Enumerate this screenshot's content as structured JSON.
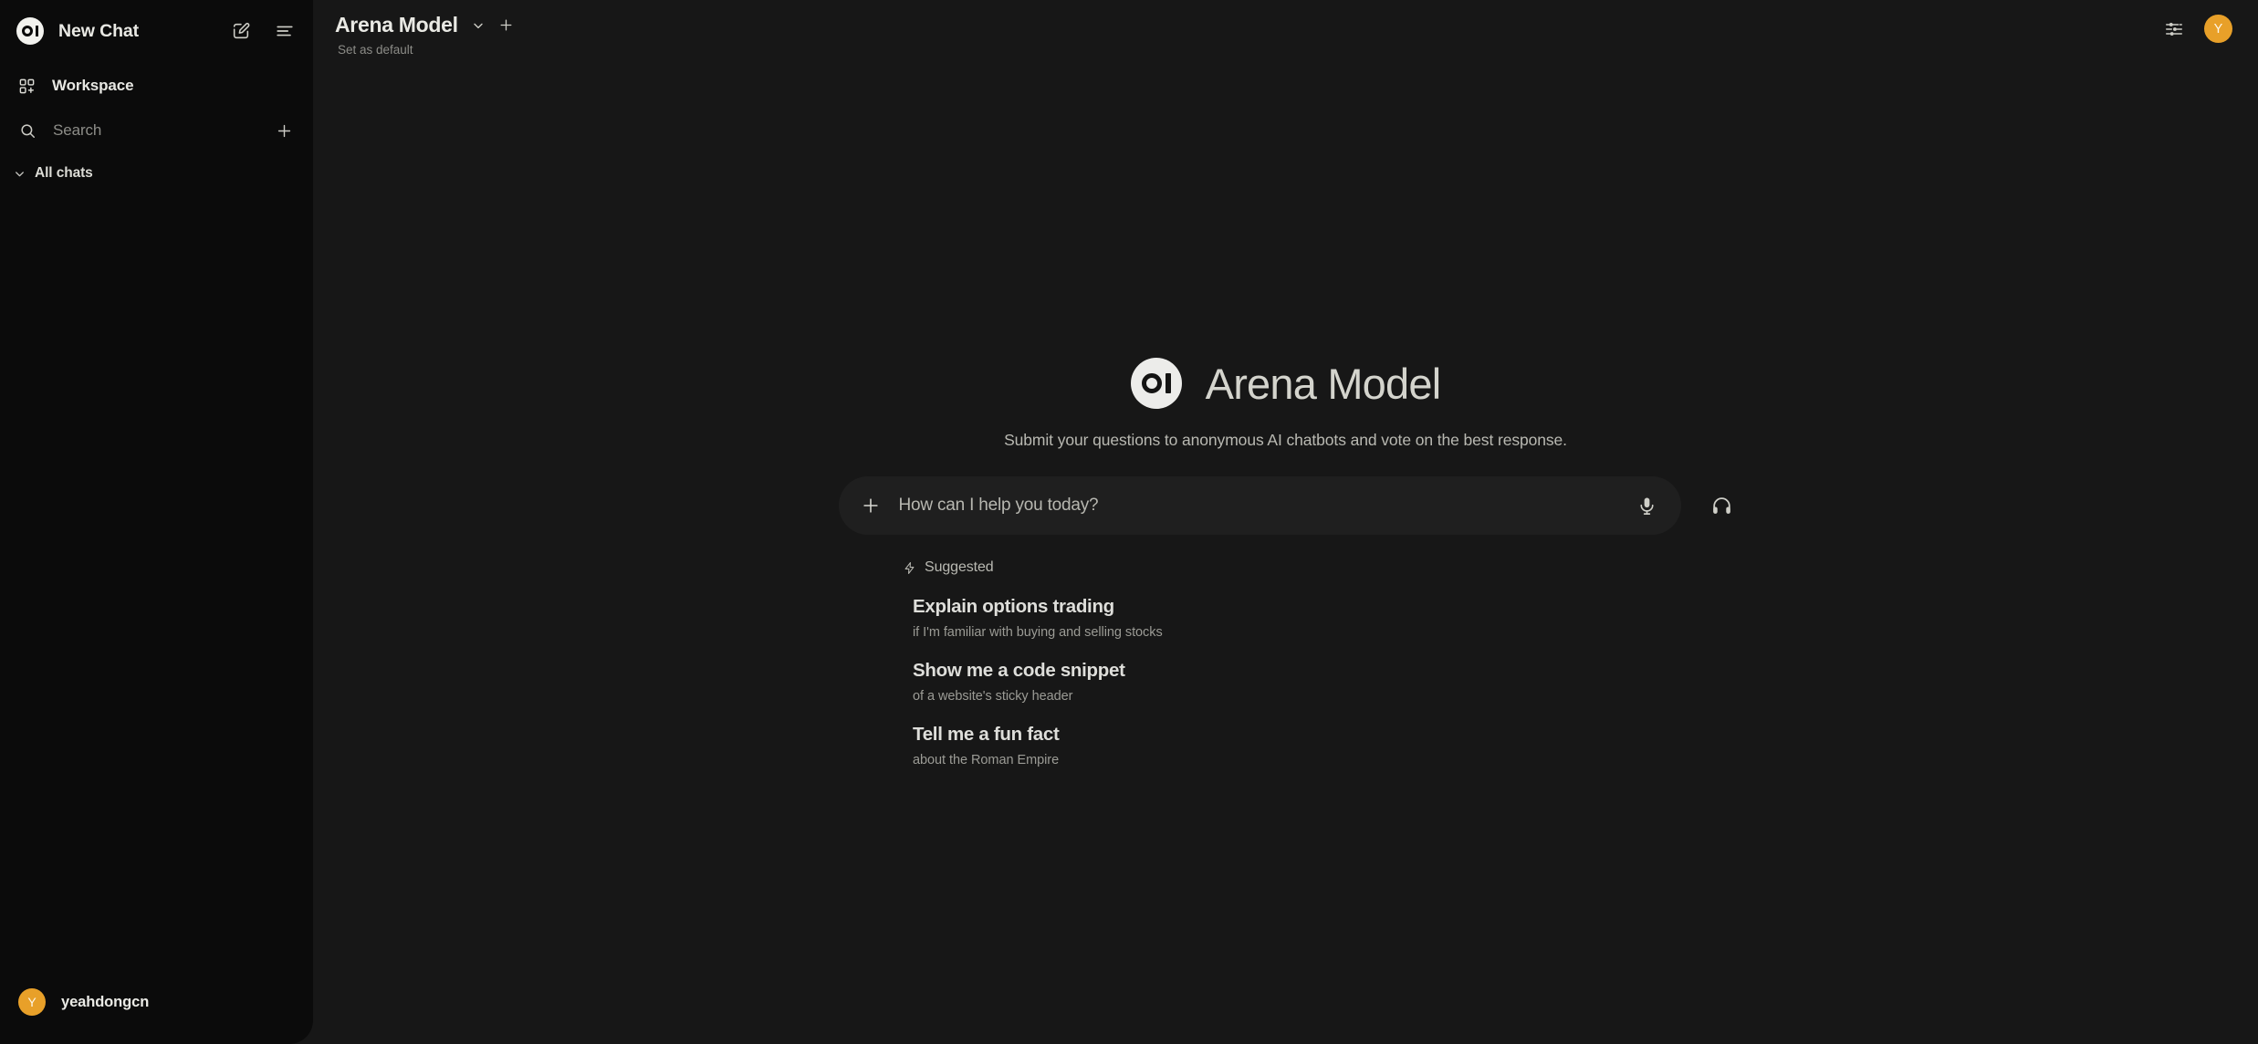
{
  "colors": {
    "sidebar_bg": "#0b0b0b",
    "main_bg": "#171717",
    "composer_bg": "#1f1f1f",
    "accent_orange": "#e8a029",
    "text_primary": "#e9e9e4",
    "text_muted": "#8c8c87"
  },
  "sidebar": {
    "logo_icon": "openwebui-logo-icon",
    "title": "New Chat",
    "new_chat_icon": "pencil-square-icon",
    "toggle_panel_icon": "panel-lines-icon",
    "workspace": {
      "icon": "grid-plus-icon",
      "label": "Workspace"
    },
    "search": {
      "icon": "search-icon",
      "placeholder": "Search",
      "value": "",
      "add_icon": "plus-icon"
    },
    "all_chats": {
      "icon": "chevron-down-icon",
      "label": "All chats"
    },
    "chats": [],
    "user": {
      "avatar_initial": "Y",
      "name": "yeahdongcn"
    }
  },
  "topbar": {
    "model_name": "Arena Model",
    "model_dropdown_icon": "chevron-down-icon",
    "add_model_icon": "plus-icon",
    "set_as_default": "Set as default",
    "controls_icon": "sliders-icon",
    "avatar_initial": "Y"
  },
  "hero": {
    "logo_icon": "openwebui-logo-icon",
    "title": "Arena Model",
    "subtitle": "Submit your questions to anonymous AI chatbots and vote on the best response."
  },
  "composer": {
    "add_icon": "plus-icon",
    "placeholder": "How can I help you today?",
    "value": "",
    "mic_icon": "microphone-icon",
    "call_icon": "headphones-icon"
  },
  "suggested": {
    "icon": "lightning-bolt-icon",
    "label": "Suggested",
    "items": [
      {
        "title": "Explain options trading",
        "desc": "if I'm familiar with buying and selling stocks"
      },
      {
        "title": "Show me a code snippet",
        "desc": "of a website's sticky header"
      },
      {
        "title": "Tell me a fun fact",
        "desc": "about the Roman Empire"
      }
    ]
  }
}
